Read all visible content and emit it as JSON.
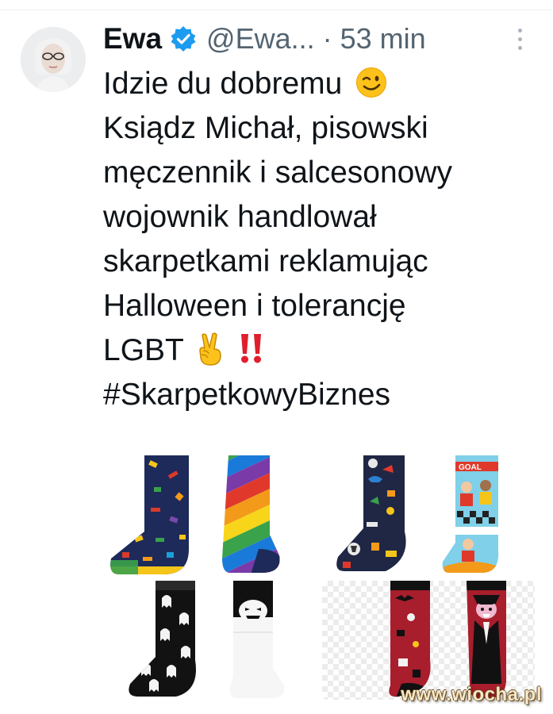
{
  "tweet": {
    "author_name": "Ewa",
    "handle": "@Ewa...",
    "separator": "·",
    "time": "53 min",
    "verified": true,
    "body_lines": [
      "Idzie du dobremu",
      "Ksiądz Michał, pisowski",
      "męczennik i salcesonowy",
      "wojownik handlował",
      "skarpetkami reklamując",
      "Halloween i tolerancję",
      "LGBT",
      "#SkarpetkowyBiznes"
    ],
    "emojis": [
      "wink-emoji",
      "victory-hand-emoji",
      "double-exclamation-emoji"
    ],
    "images": [
      {
        "name": "sock-image-lgbt"
      },
      {
        "name": "sock-image-football"
      },
      {
        "name": "sock-image-ghost"
      },
      {
        "name": "sock-image-dracula"
      }
    ]
  },
  "watermark": "www.wiocha.pl",
  "colors": {
    "text": "#0f1419",
    "muted": "#536471",
    "verified_blue": "#1d9bf0",
    "divider": "#eef1f3"
  }
}
